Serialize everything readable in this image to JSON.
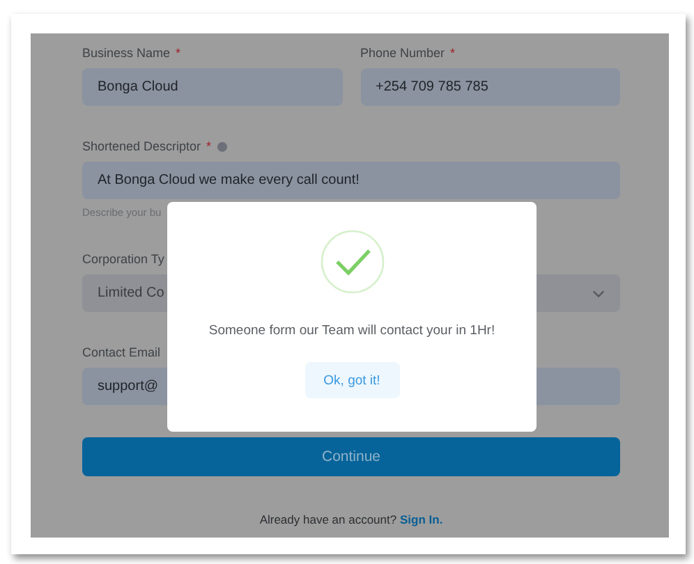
{
  "form": {
    "rows": [
      {
        "fields": [
          {
            "kind": "text",
            "label": "Business Name",
            "required_mark": "*",
            "value": "Bonga Cloud"
          },
          {
            "kind": "text",
            "label": "Phone Number",
            "required_mark": "*",
            "value": "+254 709 785 785"
          }
        ]
      },
      {
        "fields": [
          {
            "kind": "text",
            "label": "Shortened Descriptor",
            "required_mark": "*",
            "info": true,
            "value": "At Bonga Cloud we make every call count!",
            "helper": "Describe your bu"
          }
        ]
      },
      {
        "fields": [
          {
            "kind": "select",
            "label": "Corporation Ty",
            "value": "Limited Co"
          }
        ]
      },
      {
        "fields": [
          {
            "kind": "text",
            "label": "Contact Email",
            "value": "support@"
          }
        ]
      }
    ],
    "continue_button": "Continue",
    "footer": {
      "text": "Already have an account?",
      "link": "Sign In."
    }
  },
  "dialog": {
    "message": "Someone form our Team will contact your in 1Hr!",
    "button": "Ok, got it!"
  }
}
